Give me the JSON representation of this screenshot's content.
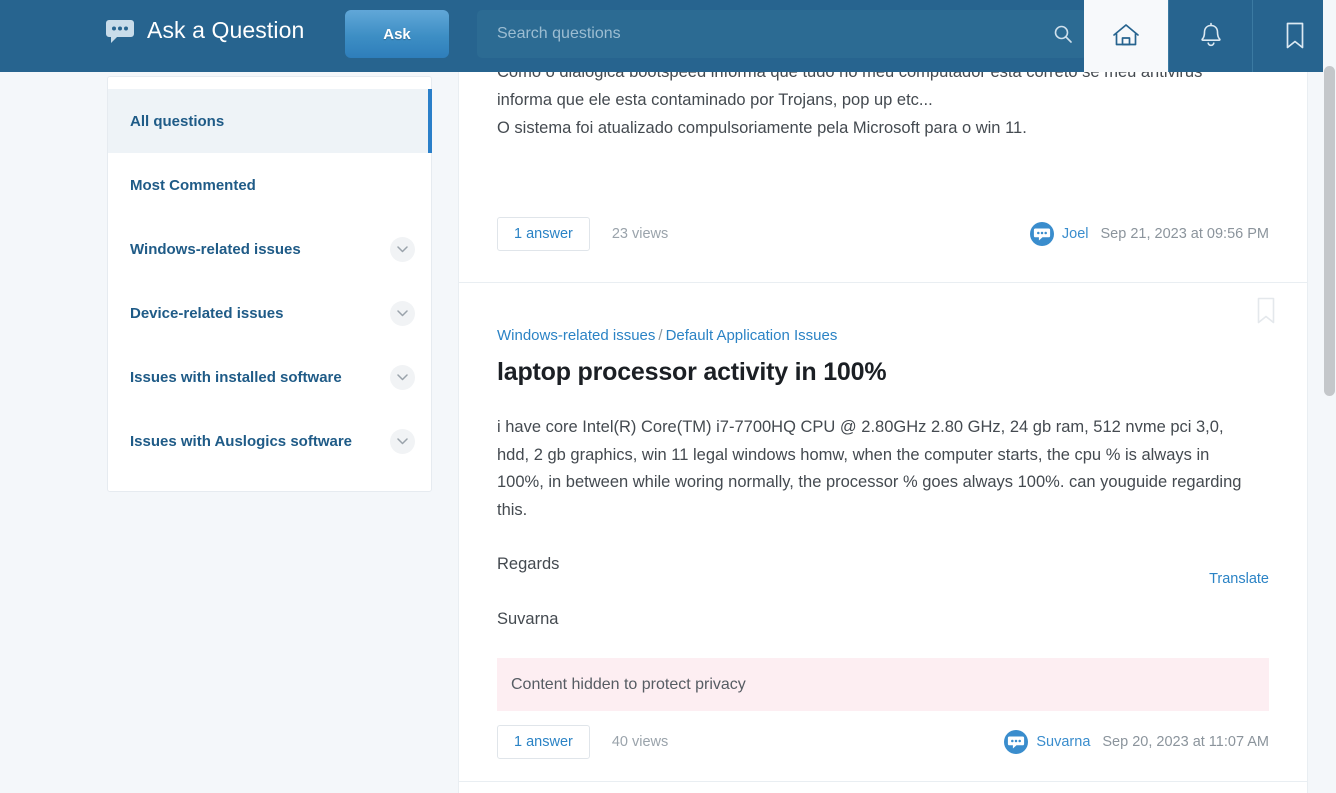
{
  "header": {
    "brand_title": "Ask a Question",
    "brand_icon": "chat-bubble-icon",
    "ask_label": "Ask",
    "search_placeholder": "Search questions",
    "search_value": "",
    "nav": [
      {
        "name": "home",
        "icon": "home-icon",
        "active": true
      },
      {
        "name": "notifications",
        "icon": "bell-icon",
        "active": false
      },
      {
        "name": "bookmarks",
        "icon": "bookmark-icon",
        "active": false
      }
    ],
    "colors": {
      "bar": "#27648f",
      "search_field": "#2c6b93",
      "ask_button": "#3d8ec4"
    }
  },
  "sidebar": {
    "items": [
      {
        "label": "All questions",
        "active": true,
        "expandable": false
      },
      {
        "label": "Most Commented",
        "active": false,
        "expandable": false
      },
      {
        "label": "Windows-related issues",
        "active": false,
        "expandable": true
      },
      {
        "label": "Device-related issues",
        "active": false,
        "expandable": true
      },
      {
        "label": "Issues with installed software",
        "active": false,
        "expandable": true
      },
      {
        "label": "Issues with Auslogics software",
        "active": false,
        "expandable": true
      }
    ],
    "active_indicator_color": "#2a7fc9"
  },
  "feed": {
    "questions": [
      {
        "clipped_line": "Como o dialogica bootspeed informa que tudo no meu computador esta correto se meu antivirus",
        "body_line_2": "informa que ele esta contaminado por Trojans, pop up etc...",
        "body_line_3": "O sistema foi atualizado compulsoriamente pela Microsoft para o win 11.",
        "answers_label": "1 answer",
        "views": "23 views",
        "author": "Joel",
        "date": "Sep 21, 2023 at 09:56 PM"
      },
      {
        "breadcrumb_parent": "Windows-related issues",
        "breadcrumb_sep": "/",
        "breadcrumb_child": "Default Application Issues",
        "translate_label": "Translate",
        "title": "laptop processor activity in 100%",
        "body_main": "i have core Intel(R) Core(TM) i7-7700HQ CPU @ 2.80GHz 2.80 GHz, 24 gb ram, 512 nvme pci 3,0, hdd, 2 gb graphics, win 11 legal windows homw, when the computer starts, the cpu % is always in 100%, in between while woring normally, the processor % goes always 100%. can youguide regarding this.",
        "body_signoff": "Regards",
        "body_name": "Suvarna",
        "privacy_notice": "Content hidden to protect privacy",
        "privacy_bg": "#fdeef2",
        "answers_label": "1 answer",
        "views": "40 views",
        "author": "Suvarna",
        "date": "Sep 20, 2023 at 11:07 AM",
        "bookmark_icon": "bookmark-outline-icon"
      }
    ]
  }
}
